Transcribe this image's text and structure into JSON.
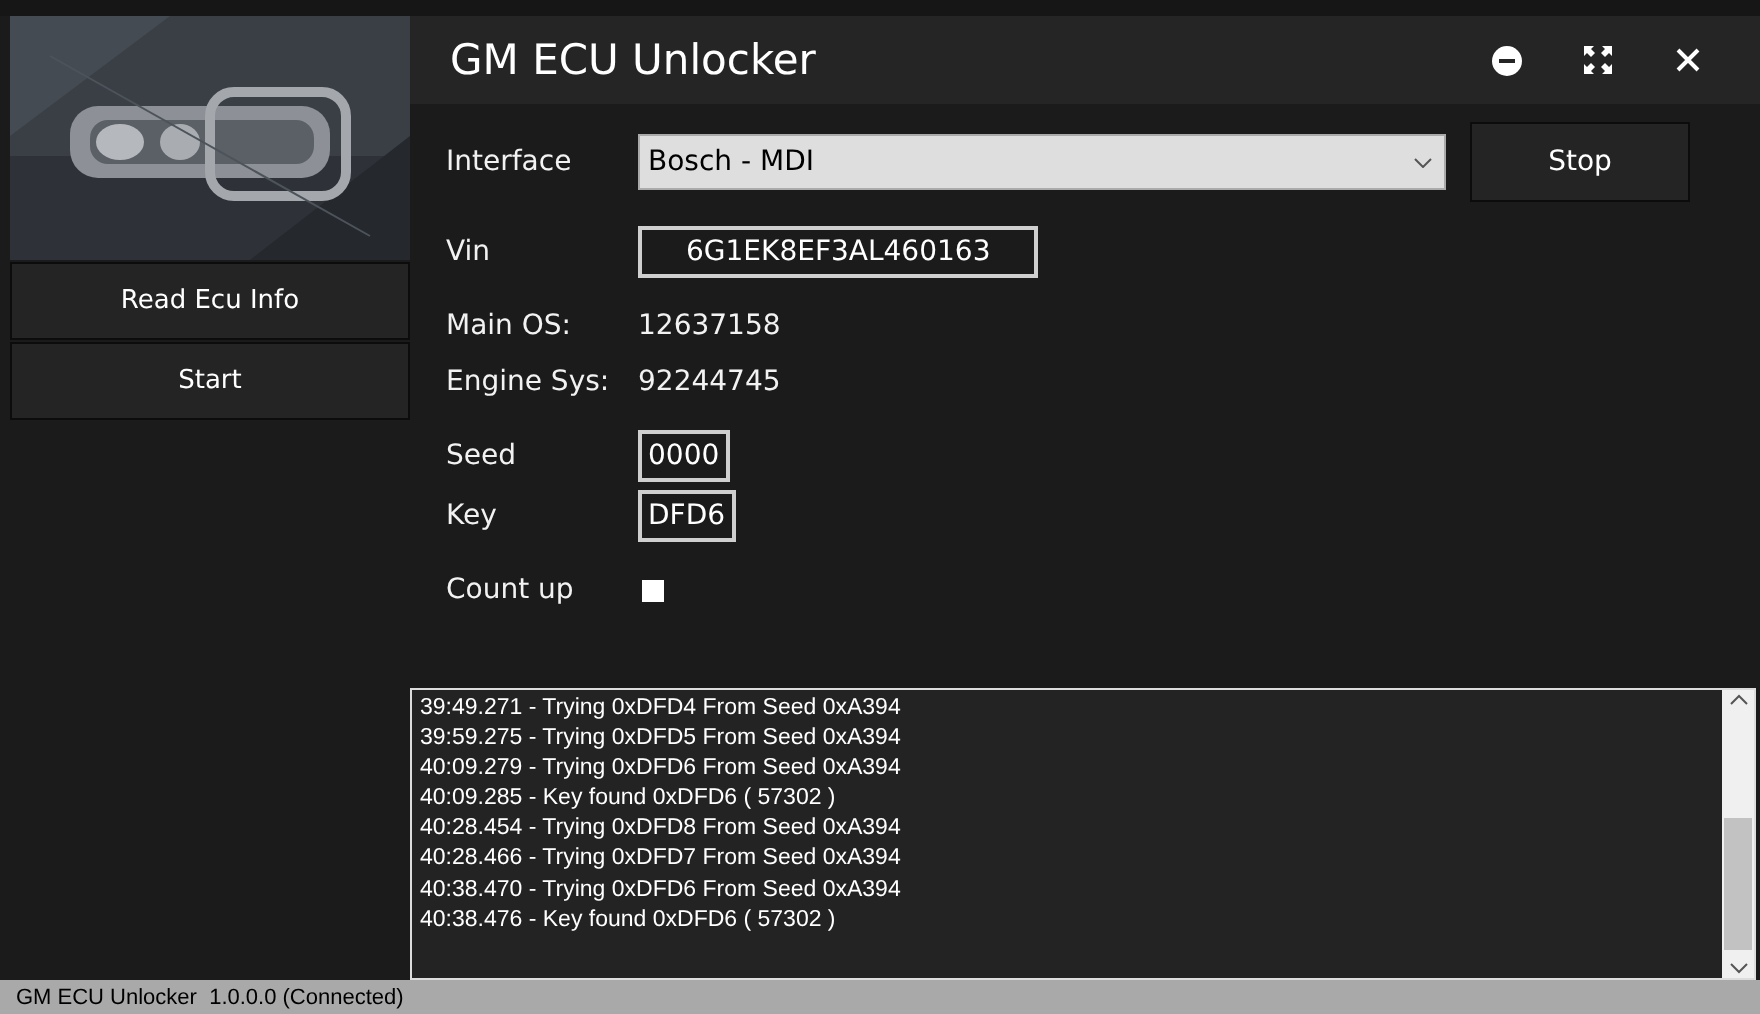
{
  "window": {
    "title": "GM ECU Unlocker"
  },
  "sidebar": {
    "buttons": [
      "Read Ecu Info",
      "Start"
    ]
  },
  "interface": {
    "label": "Interface",
    "value": "Bosch - MDI",
    "button": "Stop"
  },
  "vin": {
    "label": "Vin",
    "value": "6G1EK8EF3AL460163"
  },
  "info": [
    {
      "label": "Main OS:",
      "value": "12637158"
    },
    {
      "label": "Engine Sys:",
      "value": "92244745"
    }
  ],
  "seed": {
    "label": "Seed",
    "value": "0000"
  },
  "key": {
    "label": "Key",
    "value": "DFD6"
  },
  "count_up": {
    "label": "Count up",
    "checked": false
  },
  "log": [
    "39:49.271 - Trying 0xDFD4 From Seed 0xA394",
    "39:59.275 - Trying 0xDFD5 From Seed 0xA394",
    "40:09.279 - Trying 0xDFD6 From Seed 0xA394",
    "40:09.285 - Key found 0xDFD6 ( 57302 )",
    "40:28.454 - Trying 0xDFD8 From Seed 0xA394",
    "40:28.466 - Trying 0xDFD7 From Seed 0xA394",
    "40:38.470 - Trying 0xDFD6 From Seed 0xA394",
    "40:38.476 - Key found 0xDFD6 ( 57302 )"
  ],
  "status_bar": "GM ECU Unlocker  1.0.0.0 (Connected)"
}
